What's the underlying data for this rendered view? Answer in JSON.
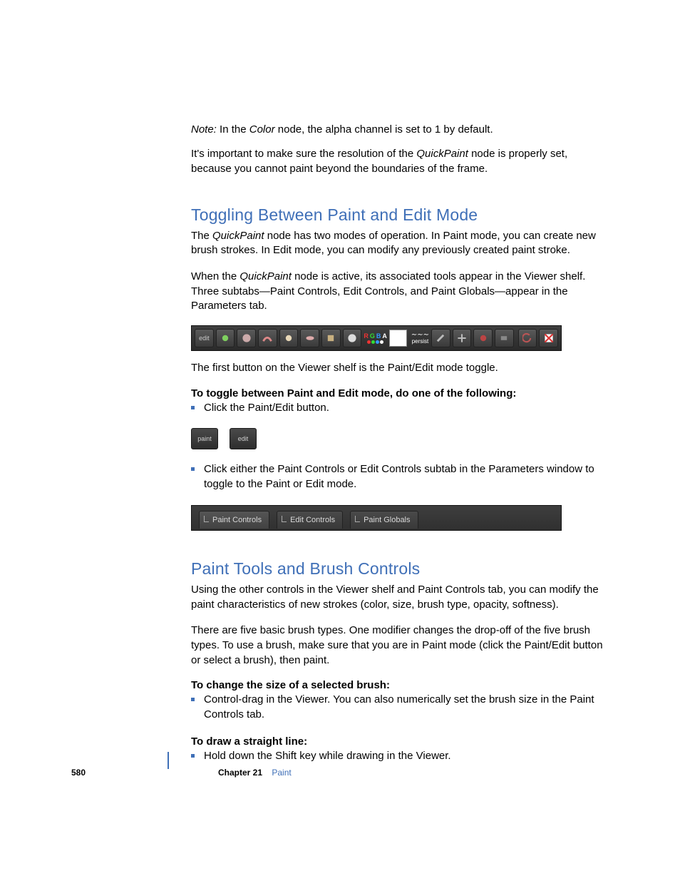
{
  "note": {
    "label": "Note:",
    "before_italic": "In the ",
    "italic": "Color",
    "after_italic": " node, the alpha channel is set to 1 by default."
  },
  "intro2_a": "It's important to make sure the resolution of the ",
  "intro2_i": "QuickPaint",
  "intro2_b": " node is properly set, because you cannot paint beyond the boundaries of the frame.",
  "section1_title": "Toggling Between Paint and Edit Mode",
  "s1_p1_a": "The ",
  "s1_p1_i": "QuickPaint",
  "s1_p1_b": " node has two modes of operation. In Paint mode, you can create new brush strokes. In Edit mode, you can modify any previously created paint stroke.",
  "s1_p2_a": "When the ",
  "s1_p2_i": "QuickPaint",
  "s1_p2_b": " node is active, its associated tools appear in the Viewer shelf. Three subtabs—Paint Controls, Edit Controls, and Paint Globals—appear in the Parameters tab.",
  "s1_caption": "The first button on the Viewer shelf is the Paint/Edit mode toggle.",
  "s1_bold": "To toggle between Paint and Edit mode, do one of the following:",
  "s1_b1": "Click the Paint/Edit button.",
  "s1_b2": "Click either the Paint Controls or Edit Controls subtab in the Parameters window to toggle to the Paint or Edit mode.",
  "chips": {
    "paint": "paint",
    "edit": "edit"
  },
  "tabs": {
    "paint_controls": "Paint Controls",
    "edit_controls": "Edit Controls",
    "paint_globals": "Paint Globals"
  },
  "strip": {
    "edit_btn": "edit",
    "persist": "persist",
    "rgba": "RGBA"
  },
  "section2_title": "Paint Tools and Brush Controls",
  "s2_p1": "Using the other controls in the Viewer shelf and Paint Controls tab, you can modify the paint characteristics of new strokes (color, size, brush type, opacity, softness).",
  "s2_p2": "There are five basic brush types. One modifier changes the drop-off of the five brush types. To use a brush, make sure that you are in Paint mode (click the Paint/Edit button or select a brush), then paint.",
  "s2_bold1": "To change the size of a selected brush:",
  "s2_b1": "Control-drag in the Viewer. You can also numerically set the brush size in the Paint Controls tab.",
  "s2_bold2": "To draw a straight line:",
  "s2_b2": "Hold down the Shift key while drawing in the Viewer.",
  "footer": {
    "page_number": "580",
    "chapter_label": "Chapter 21",
    "chapter_title": "Paint"
  }
}
